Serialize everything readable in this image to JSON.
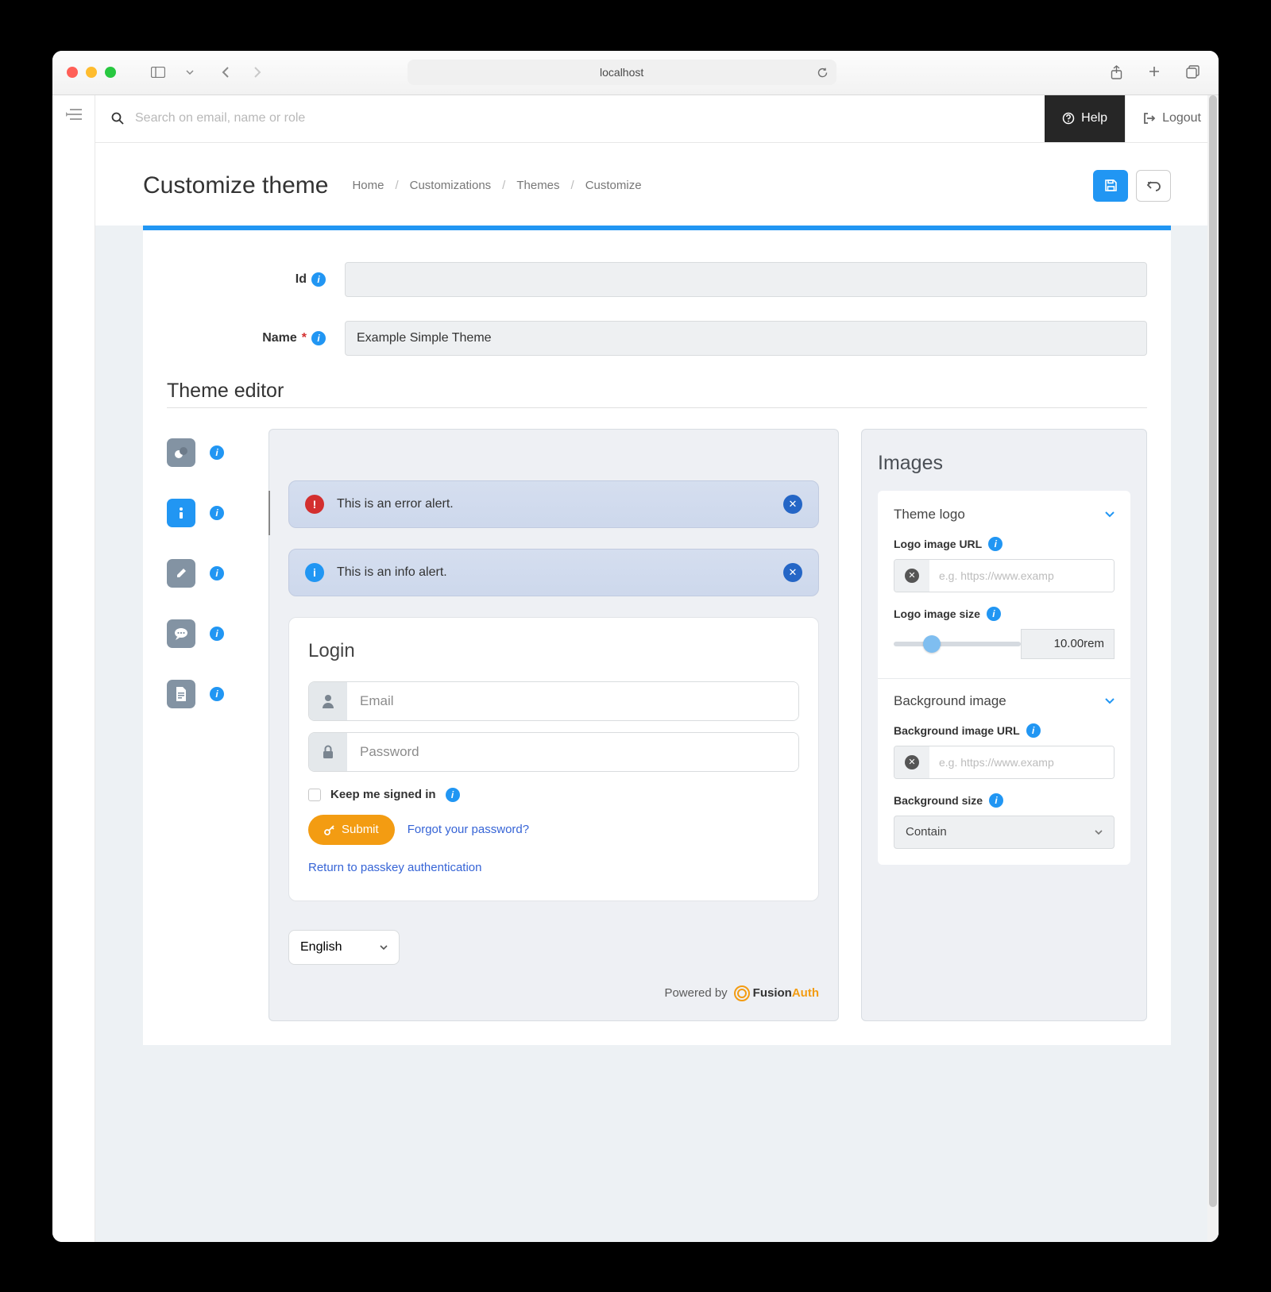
{
  "browser": {
    "url": "localhost"
  },
  "topbar": {
    "search_placeholder": "Search on email, name or role",
    "help": "Help",
    "logout": "Logout"
  },
  "page": {
    "title": "Customize theme",
    "breadcrumb": [
      "Home",
      "Customizations",
      "Themes",
      "Customize"
    ]
  },
  "form": {
    "id_label": "Id",
    "id_value": "",
    "name_label": "Name",
    "name_value": "Example Simple Theme"
  },
  "section": {
    "editor_heading": "Theme editor"
  },
  "preview": {
    "error_alert": "This is an error alert.",
    "info_alert": "This is an info alert.",
    "login_heading": "Login",
    "email_placeholder": "Email",
    "password_placeholder": "Password",
    "keep_signed": "Keep me signed in",
    "submit": "Submit",
    "forgot": "Forgot your password?",
    "passkey": "Return to passkey authentication",
    "language": "English",
    "powered": "Powered by",
    "brand": "FusionAuth"
  },
  "settings": {
    "heading": "Images",
    "theme_logo": "Theme logo",
    "logo_url_label": "Logo image URL",
    "url_placeholder": "e.g. https://www.examp",
    "logo_size_label": "Logo image size",
    "logo_size_value": "10.00rem",
    "bg_heading": "Background image",
    "bg_url_label": "Background image URL",
    "bg_size_label": "Background size",
    "bg_size_value": "Contain"
  }
}
